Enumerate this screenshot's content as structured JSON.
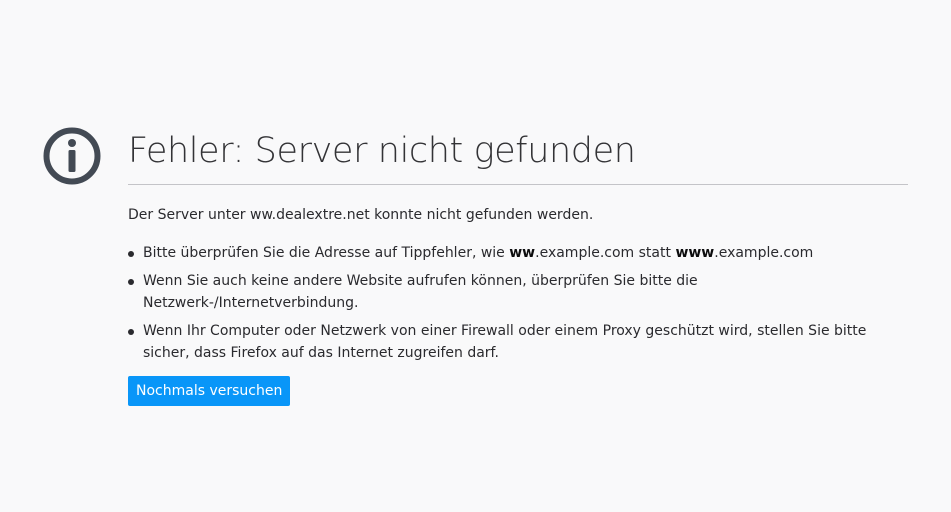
{
  "error": {
    "title": "Fehler: Server nicht gefunden",
    "description": "Der Server unter ww.dealextre.net konnte nicht gefunden werden.",
    "tips": [
      {
        "parts": [
          {
            "text": "Bitte überprüfen Sie die Adresse auf Tippfehler, wie ",
            "bold": false
          },
          {
            "text": "ww",
            "bold": true
          },
          {
            "text": ".example.com statt ",
            "bold": false
          },
          {
            "text": "www",
            "bold": true
          },
          {
            "text": ".example.com",
            "bold": false
          }
        ]
      },
      {
        "parts": [
          {
            "text": "Wenn Sie auch keine andere Website aufrufen können, überprüfen Sie bitte die Netzwerk-/Internetverbindung.",
            "bold": false
          }
        ]
      },
      {
        "parts": [
          {
            "text": "Wenn Ihr Computer oder Netzwerk von einer Firewall oder einem Proxy geschützt wird, stellen Sie bitte sicher, dass Firefox auf das Internet zugreifen darf.",
            "bold": false
          }
        ]
      }
    ],
    "retry_label": "Nochmals versuchen",
    "icon": "info-icon"
  },
  "colors": {
    "background": "#f9f9fa",
    "icon": "#434a54",
    "button": "#0996f8"
  }
}
